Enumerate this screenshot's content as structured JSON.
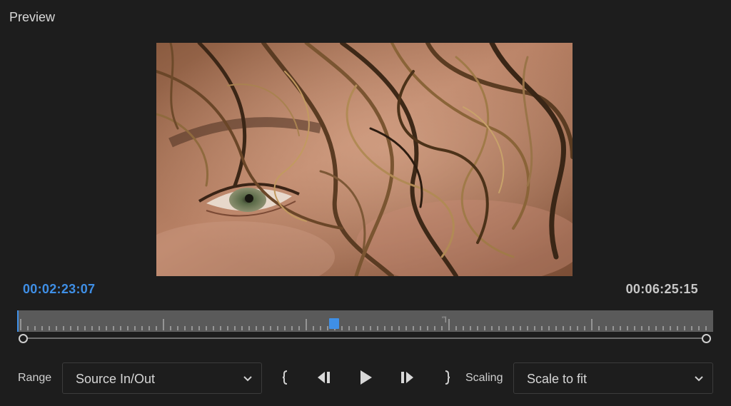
{
  "panel": {
    "title": "Preview"
  },
  "timecode": {
    "current": "00:02:23:07",
    "duration": "00:06:25:15"
  },
  "timeline": {
    "playhead_fraction": 0.455
  },
  "controls": {
    "range_label": "Range",
    "range_value": "Source In/Out",
    "scaling_label": "Scaling",
    "scaling_value": "Scale to fit"
  },
  "icons": {
    "set_in": "brace-left-icon",
    "step_back": "step-back-icon",
    "play": "play-icon",
    "step_forward": "step-forward-icon",
    "set_out": "brace-right-icon",
    "dropdown": "chevron-down-icon"
  },
  "colors": {
    "accent": "#3f8fe6",
    "background": "#1d1d1d"
  }
}
